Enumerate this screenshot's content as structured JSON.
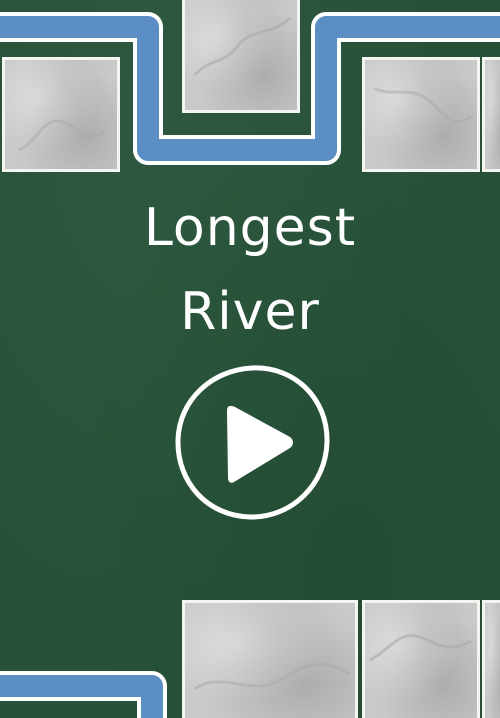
{
  "game": {
    "title_line1": "Longest",
    "title_line2": "River"
  },
  "colors": {
    "background": "#275239",
    "river": "#5a8ec4",
    "river_border": "#ffffff",
    "tile": "#c9c9c9"
  },
  "icons": {
    "play": "play-icon"
  }
}
